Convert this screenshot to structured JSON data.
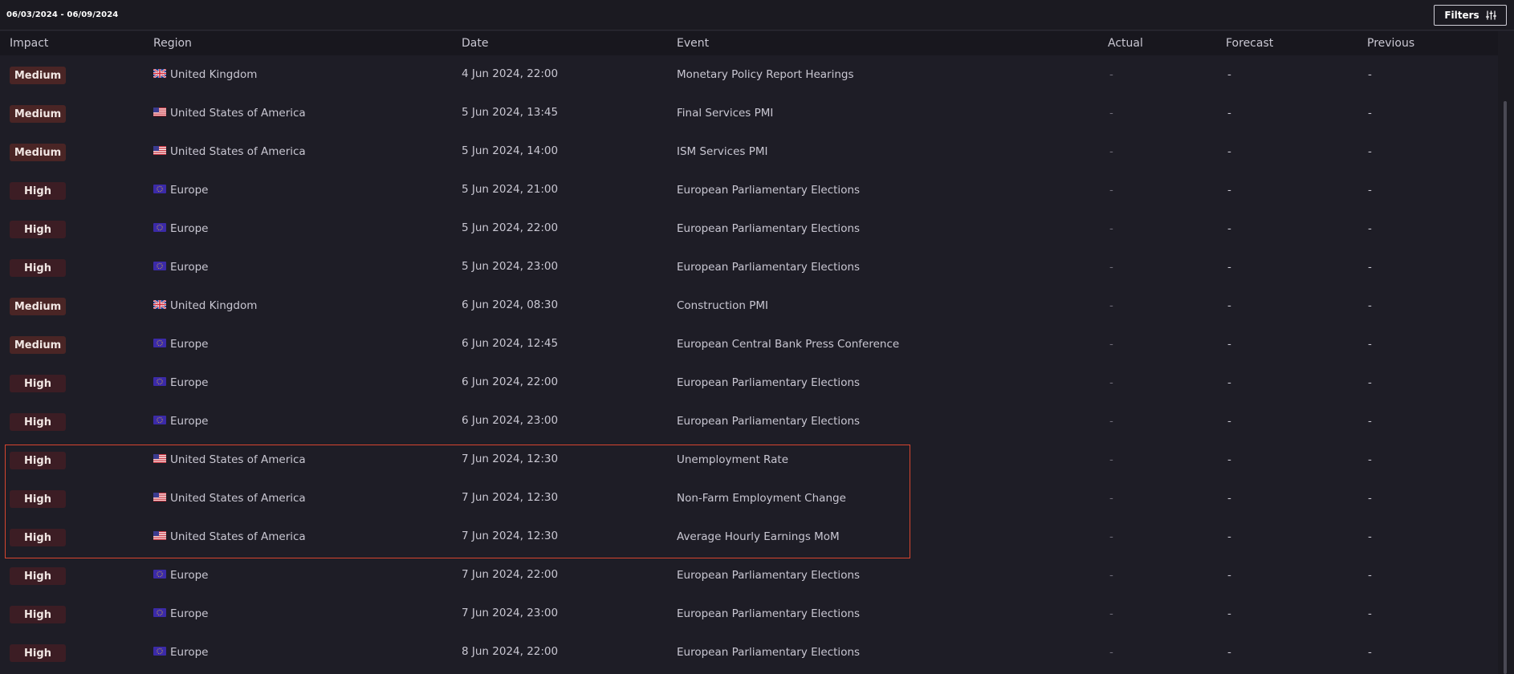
{
  "toolbar": {
    "date_range": "06/03/2024 - 06/09/2024",
    "filters_label": "Filters"
  },
  "columns": {
    "impact": "Impact",
    "region": "Region",
    "date": "Date",
    "event": "Event",
    "actual": "Actual",
    "forecast": "Forecast",
    "previous": "Previous"
  },
  "colors": {
    "medium_badge": "#4a2525",
    "high_badge": "#3c1d24",
    "highlight_border": "#d7452f"
  },
  "rows": [
    {
      "impact": "Medium",
      "flag": "uk-flag-icon",
      "region": "United Kingdom",
      "date": "4 Jun 2024, 22:00",
      "event": "Monetary Policy Report Hearings",
      "actual": "-",
      "forecast": "-",
      "previous": "-"
    },
    {
      "impact": "Medium",
      "flag": "us-flag-icon",
      "region": "United States of America",
      "date": "5 Jun 2024, 13:45",
      "event": "Final Services PMI",
      "actual": "-",
      "forecast": "-",
      "previous": "-"
    },
    {
      "impact": "Medium",
      "flag": "us-flag-icon",
      "region": "United States of America",
      "date": "5 Jun 2024, 14:00",
      "event": "ISM Services PMI",
      "actual": "-",
      "forecast": "-",
      "previous": "-"
    },
    {
      "impact": "High",
      "flag": "eu-flag-icon",
      "region": "Europe",
      "date": "5 Jun 2024, 21:00",
      "event": "European Parliamentary Elections",
      "actual": "-",
      "forecast": "-",
      "previous": "-"
    },
    {
      "impact": "High",
      "flag": "eu-flag-icon",
      "region": "Europe",
      "date": "5 Jun 2024, 22:00",
      "event": "European Parliamentary Elections",
      "actual": "-",
      "forecast": "-",
      "previous": "-"
    },
    {
      "impact": "High",
      "flag": "eu-flag-icon",
      "region": "Europe",
      "date": "5 Jun 2024, 23:00",
      "event": "European Parliamentary Elections",
      "actual": "-",
      "forecast": "-",
      "previous": "-"
    },
    {
      "impact": "Medium",
      "flag": "uk-flag-icon",
      "region": "United Kingdom",
      "date": "6 Jun 2024, 08:30",
      "event": "Construction PMI",
      "actual": "-",
      "forecast": "-",
      "previous": "-"
    },
    {
      "impact": "Medium",
      "flag": "eu-flag-icon",
      "region": "Europe",
      "date": "6 Jun 2024, 12:45",
      "event": "European Central Bank Press Conference",
      "actual": "-",
      "forecast": "-",
      "previous": "-"
    },
    {
      "impact": "High",
      "flag": "eu-flag-icon",
      "region": "Europe",
      "date": "6 Jun 2024, 22:00",
      "event": "European Parliamentary Elections",
      "actual": "-",
      "forecast": "-",
      "previous": "-"
    },
    {
      "impact": "High",
      "flag": "eu-flag-icon",
      "region": "Europe",
      "date": "6 Jun 2024, 23:00",
      "event": "European Parliamentary Elections",
      "actual": "-",
      "forecast": "-",
      "previous": "-"
    },
    {
      "impact": "High",
      "flag": "us-flag-icon",
      "region": "United States of America",
      "date": "7 Jun 2024, 12:30",
      "event": "Unemployment Rate",
      "actual": "-",
      "forecast": "-",
      "previous": "-"
    },
    {
      "impact": "High",
      "flag": "us-flag-icon",
      "region": "United States of America",
      "date": "7 Jun 2024, 12:30",
      "event": "Non-Farm Employment Change",
      "actual": "-",
      "forecast": "-",
      "previous": "-"
    },
    {
      "impact": "High",
      "flag": "us-flag-icon",
      "region": "United States of America",
      "date": "7 Jun 2024, 12:30",
      "event": "Average Hourly Earnings MoM",
      "actual": "-",
      "forecast": "-",
      "previous": "-"
    },
    {
      "impact": "High",
      "flag": "eu-flag-icon",
      "region": "Europe",
      "date": "7 Jun 2024, 22:00",
      "event": "European Parliamentary Elections",
      "actual": "-",
      "forecast": "-",
      "previous": "-"
    },
    {
      "impact": "High",
      "flag": "eu-flag-icon",
      "region": "Europe",
      "date": "7 Jun 2024, 23:00",
      "event": "European Parliamentary Elections",
      "actual": "-",
      "forecast": "-",
      "previous": "-"
    },
    {
      "impact": "High",
      "flag": "eu-flag-icon",
      "region": "Europe",
      "date": "8 Jun 2024, 22:00",
      "event": "European Parliamentary Elections",
      "actual": "-",
      "forecast": "-",
      "previous": "-"
    }
  ]
}
